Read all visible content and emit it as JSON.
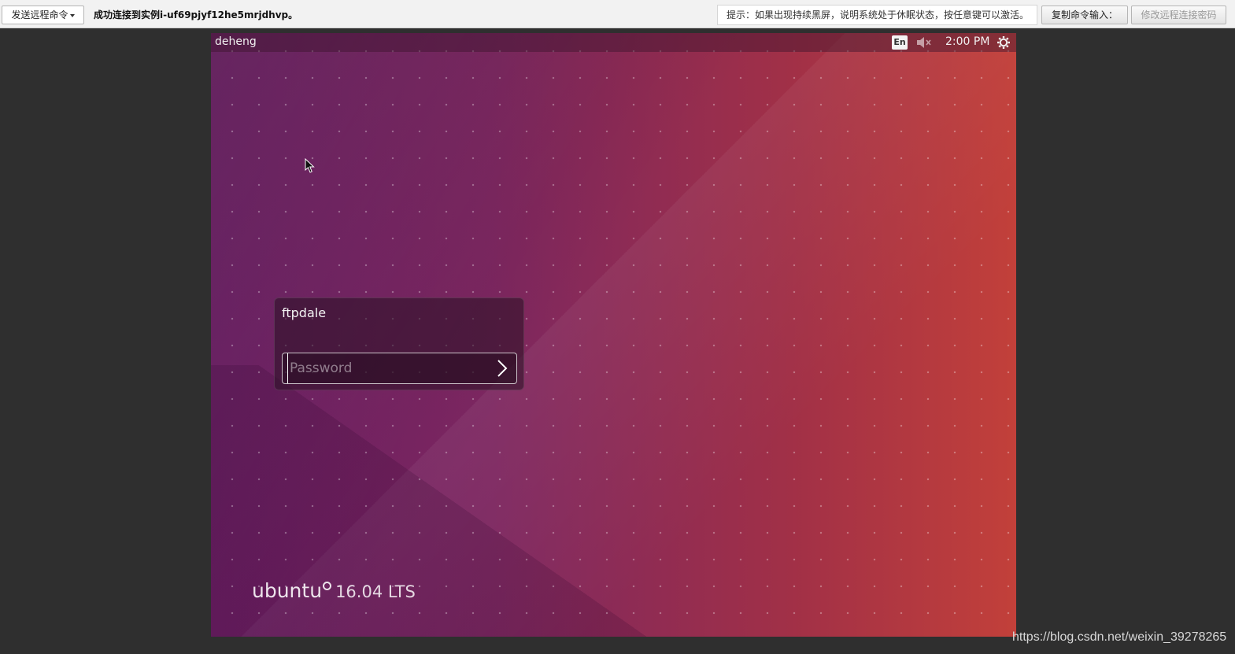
{
  "toolbar": {
    "send_command_label": "发送远程命令",
    "status_text": "成功连接到实例i-uf69pjyf12he5mrjdhvp。",
    "hint_text": "提示：如果出现持续黑屏，说明系统处于休眠状态，按任意键可以激活。",
    "copy_command_label": "复制命令输入：",
    "change_password_label": "修改远程连接密码"
  },
  "desktop": {
    "hostname": "deheng",
    "language_indicator": "En",
    "volume_icon": "volume-muted-icon",
    "clock": "2:00 PM",
    "power_icon": "gear-power-icon",
    "login": {
      "username": "ftpdale",
      "password_placeholder": "Password",
      "submit_icon": "chevron-right-icon"
    },
    "branding": {
      "logo_text": "ubuntu",
      "version": "16.04 LTS"
    },
    "colors": {
      "wallpaper_left": "#6e1f66",
      "wallpaper_right": "#c2403a"
    }
  },
  "watermark": "https://blog.csdn.net/weixin_39278265"
}
